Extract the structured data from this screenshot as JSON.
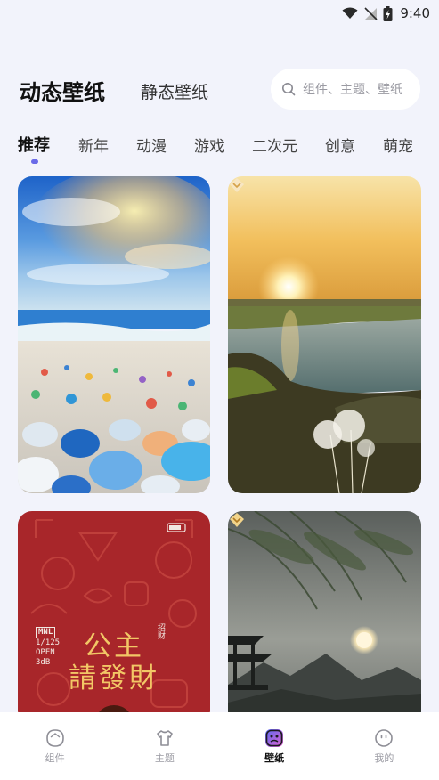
{
  "status_bar": {
    "time": "9:40"
  },
  "header": {
    "tab_active": "动态壁纸",
    "tab_inactive": "静态壁纸",
    "search_placeholder": "组件、主题、壁纸"
  },
  "categories": [
    "推荐",
    "新年",
    "动漫",
    "游戏",
    "二次元",
    "创意",
    "萌宠"
  ],
  "active_category": "推荐",
  "wallpapers": [
    {
      "name": "sea-glass-beach",
      "vip": false
    },
    {
      "name": "sunset-lake-dandelion",
      "vip": true
    },
    {
      "name": "red-fortune-poster",
      "vip": false,
      "poster_title_line1": "公主",
      "poster_title_line2": "請發財",
      "poster_meta_tag": "MNL",
      "poster_meta_lines": [
        "1/125",
        "OPEN",
        "3dB"
      ],
      "poster_side_text": "招财"
    },
    {
      "name": "moonlit-pavilion-willow",
      "vip": true
    }
  ],
  "bottom_nav": {
    "items": [
      {
        "label": "组件",
        "icon": "widget-icon",
        "active": false
      },
      {
        "label": "主题",
        "icon": "shirt-icon",
        "active": false
      },
      {
        "label": "壁纸",
        "icon": "wallpaper-icon",
        "active": true
      },
      {
        "label": "我的",
        "icon": "profile-icon",
        "active": false
      }
    ]
  },
  "colors": {
    "background": "#f2f3fb",
    "accent": "#6a6ae8",
    "poster_red": "#a8262a",
    "poster_gold": "#f2c766"
  }
}
